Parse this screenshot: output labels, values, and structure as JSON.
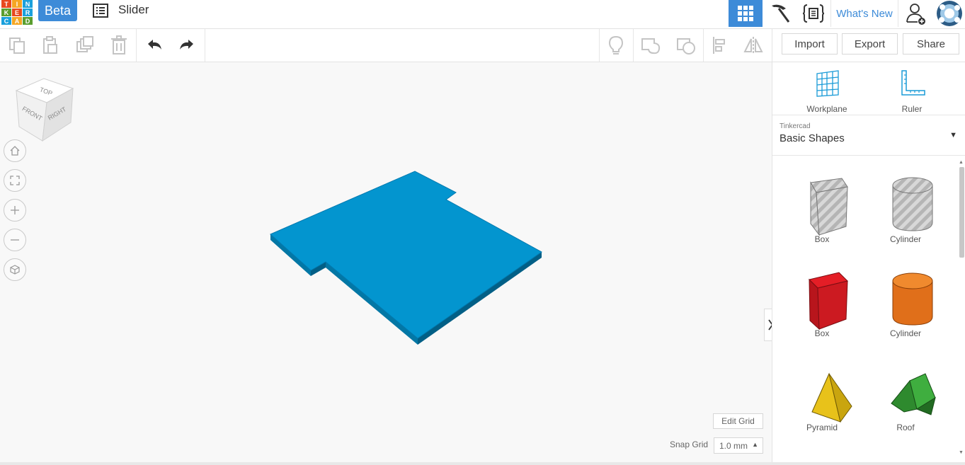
{
  "app": {
    "logo_letters": [
      "T",
      "I",
      "N",
      "K",
      "E",
      "R",
      "C",
      "A",
      "D"
    ],
    "logo_colors": [
      "#e8481e",
      "#f5a623",
      "#1aa0dc",
      "#5b9e2f",
      "#e8481e",
      "#1aa0dc",
      "#1aa0dc",
      "#f5a623",
      "#5b9e2f"
    ],
    "beta_label": "Beta",
    "design_title": "Slider",
    "whats_new": "What's New",
    "accent": "#3d8bd8"
  },
  "actions": {
    "import": "Import",
    "export": "Export",
    "share": "Share"
  },
  "viewcube": {
    "top": "TOP",
    "front": "FRONT",
    "right": "RIGHT"
  },
  "workplane": {
    "edit_grid": "Edit Grid",
    "snap_grid_label": "Snap Grid",
    "snap_grid_value": "1.0 mm",
    "shape_color": "#0395cf"
  },
  "panel": {
    "tools": [
      {
        "label": "Workplane",
        "icon": "workplane-icon"
      },
      {
        "label": "Ruler",
        "icon": "ruler-icon"
      }
    ],
    "library_source": "Tinkercad",
    "library_name": "Basic Shapes",
    "shapes": [
      {
        "label": "Box",
        "kind": "box-hole"
      },
      {
        "label": "Cylinder",
        "kind": "cylinder-hole"
      },
      {
        "label": "Box",
        "kind": "box-solid"
      },
      {
        "label": "Cylinder",
        "kind": "cylinder-solid"
      },
      {
        "label": "Pyramid",
        "kind": "pyramid"
      },
      {
        "label": "Roof",
        "kind": "roof"
      }
    ]
  }
}
